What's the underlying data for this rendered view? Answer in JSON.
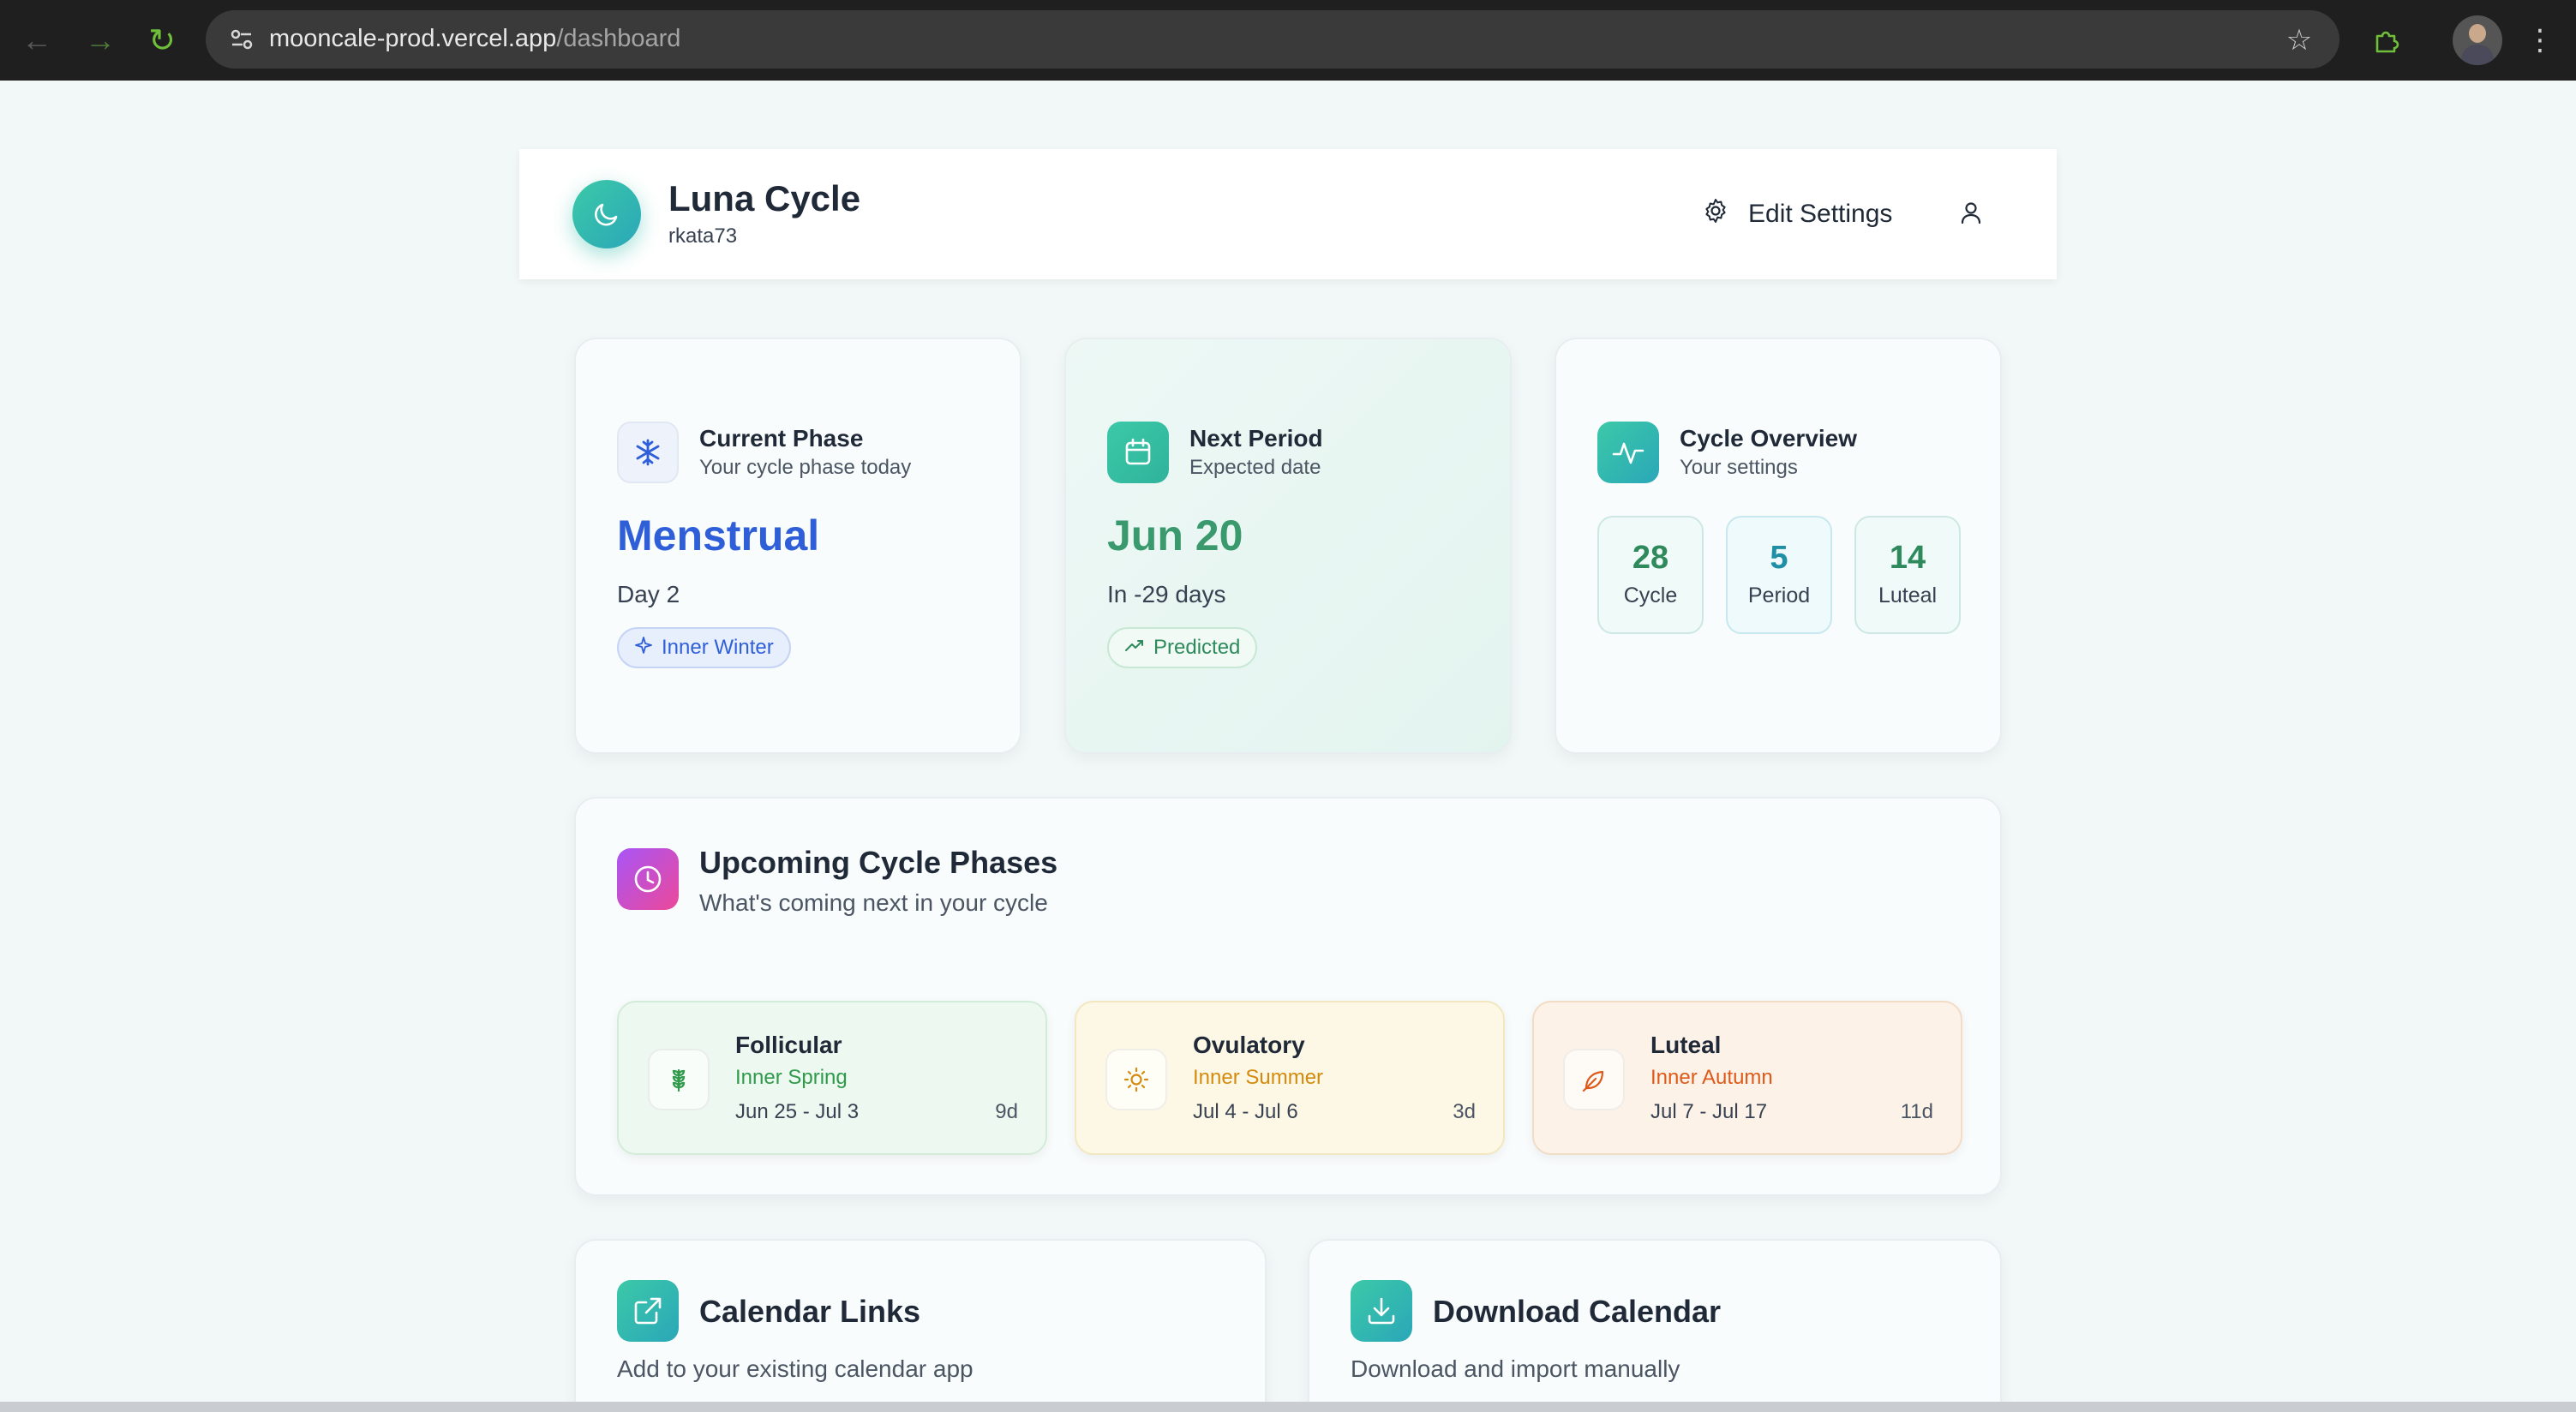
{
  "browser": {
    "url_domain": "mooncale-prod.vercel.app",
    "url_path": "/dashboard"
  },
  "header": {
    "title": "Luna Cycle",
    "username": "rkata73",
    "settings_label": "Edit Settings"
  },
  "current_phase": {
    "title": "Current Phase",
    "subtitle": "Your cycle phase today",
    "value": "Menstrual",
    "day": "Day 2",
    "badge": "Inner Winter",
    "color": "#2f5fd8"
  },
  "next_period": {
    "title": "Next Period",
    "subtitle": "Expected date",
    "value": "Jun 20",
    "countdown": "In -29 days",
    "badge": "Predicted",
    "color": "#3a9a6e"
  },
  "cycle_overview": {
    "title": "Cycle Overview",
    "subtitle": "Your settings",
    "stats": [
      {
        "value": "28",
        "label": "Cycle"
      },
      {
        "value": "5",
        "label": "Period"
      },
      {
        "value": "14",
        "label": "Luteal"
      }
    ]
  },
  "upcoming": {
    "title": "Upcoming Cycle Phases",
    "subtitle": "What's coming next in your cycle",
    "phases": [
      {
        "name": "Follicular",
        "alias": "Inner Spring",
        "dates": "Jun 25 - Jul 3",
        "duration": "9d",
        "icon": "sprout-icon",
        "color": "#2e9a4a"
      },
      {
        "name": "Ovulatory",
        "alias": "Inner Summer",
        "dates": "Jul 4 - Jul 6",
        "duration": "3d",
        "icon": "sun-icon",
        "color": "#d48a0c"
      },
      {
        "name": "Luteal",
        "alias": "Inner Autumn",
        "dates": "Jul 7 - Jul 17",
        "duration": "11d",
        "icon": "leaf-icon",
        "color": "#dd5a1a"
      }
    ]
  },
  "calendar_links": {
    "title": "Calendar Links",
    "subtitle": "Add to your existing calendar app"
  },
  "download_calendar": {
    "title": "Download Calendar",
    "subtitle": "Download and import manually"
  }
}
